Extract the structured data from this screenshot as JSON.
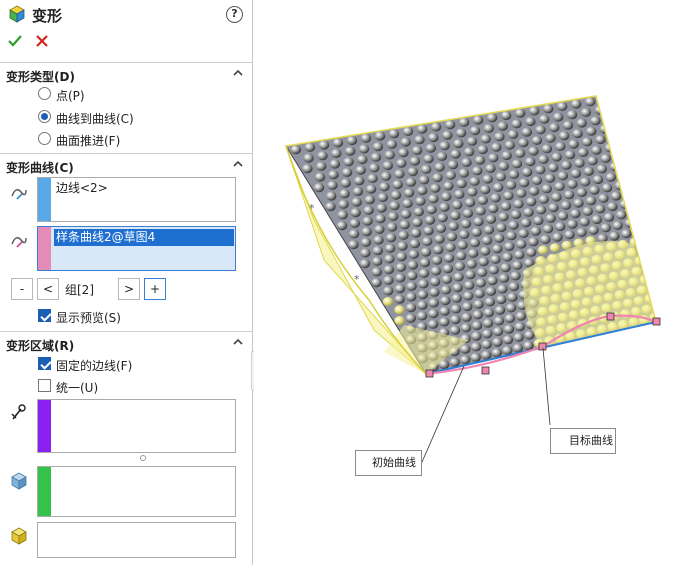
{
  "panel": {
    "title": "变形",
    "help": "?",
    "sections": {
      "type": {
        "label": "变形类型(D)"
      },
      "curves": {
        "label": "变形曲线(C)"
      },
      "region": {
        "label": "变形区域(R)"
      }
    },
    "type_options": [
      {
        "label": "点(P)",
        "selected": false
      },
      {
        "label": "曲线到曲线(C)",
        "selected": true
      },
      {
        "label": "曲面推进(F)",
        "selected": false
      }
    ],
    "initial_curves": [
      "边线<2>"
    ],
    "target_curves": [
      "样条曲线2@草图4"
    ],
    "group_buttons": {
      "minus": "-",
      "prev": "<",
      "next": ">",
      "plus": "+"
    },
    "group_label": "组[2]",
    "show_preview": {
      "label": "显示预览(S)",
      "checked": true
    },
    "fixed_edges": {
      "label": "固定的边线(F)",
      "checked": true
    },
    "uniform": {
      "label": "统一(U)",
      "checked": false
    },
    "swatch_colors": {
      "initial": "#5aa9e6",
      "target": "#e58bb8",
      "fixed": "#8a1ff2",
      "faces": "#34c24a"
    }
  },
  "viewport": {
    "callout_initial": "初始曲线",
    "callout_target": "目标曲线"
  }
}
